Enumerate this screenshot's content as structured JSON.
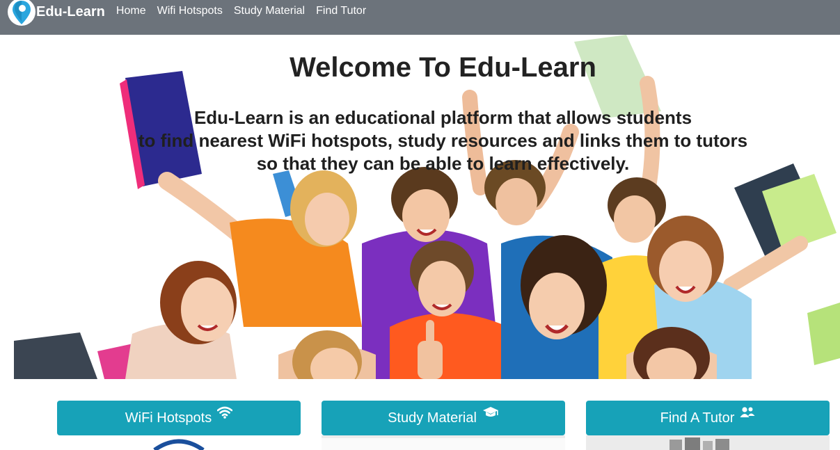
{
  "navbar": {
    "brand": "Edu-Learn",
    "logo_icon": "map-pin-icon",
    "links": [
      {
        "label": "Home"
      },
      {
        "label": "Wifi Hotspots"
      },
      {
        "label": "Study Material"
      },
      {
        "label": "Find Tutor"
      }
    ],
    "background_color": "#6c737b"
  },
  "hero": {
    "title": "Welcome To Edu-Learn",
    "description_lines": [
      "Edu-Learn is an educational platform that allows students",
      "to find nearest WiFi hotspots, study resources and links them to tutors",
      "so that they can be able to learn effectively."
    ],
    "image_subject": "group of cheering students holding books"
  },
  "cards": [
    {
      "label": "WiFi Hotspots",
      "icon": "wifi-icon"
    },
    {
      "label": "Study Material",
      "icon": "graduation-cap-icon"
    },
    {
      "label": "Find A Tutor",
      "icon": "users-icon"
    }
  ],
  "accent_color": "#17a2b8"
}
